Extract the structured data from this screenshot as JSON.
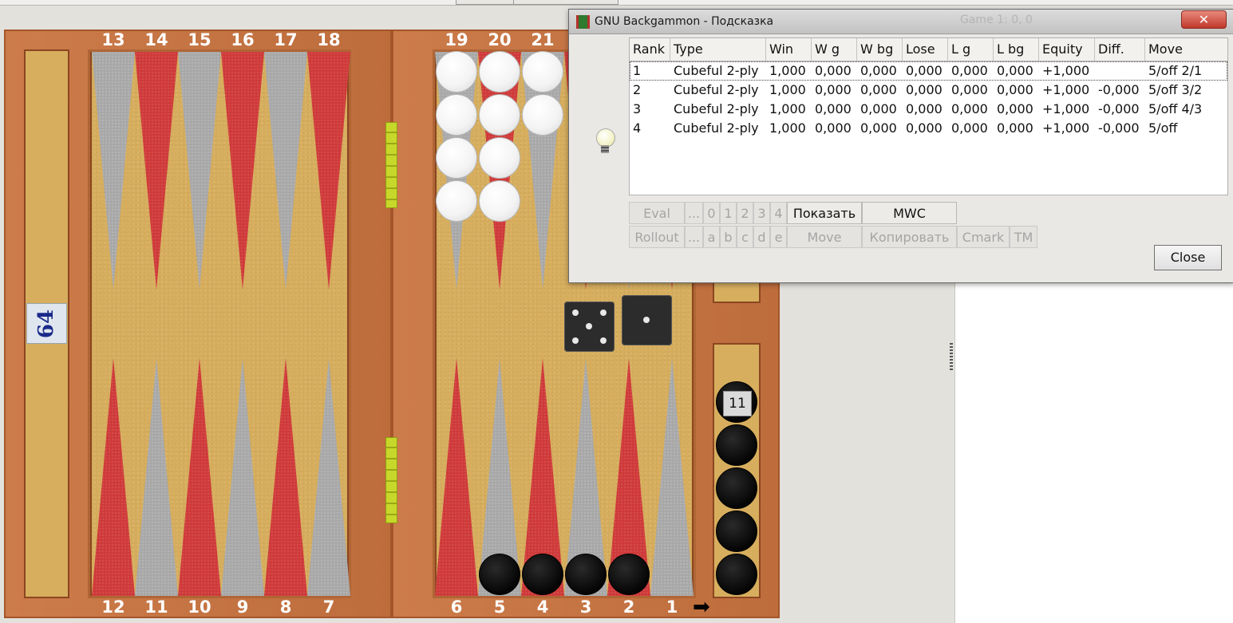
{
  "board": {
    "top_point_numbers": [
      "13",
      "14",
      "15",
      "16",
      "17",
      "18",
      "19",
      "20",
      "21"
    ],
    "bottom_point_numbers": [
      "12",
      "11",
      "10",
      "9",
      "8",
      "7",
      "6",
      "5",
      "4",
      "3",
      "2",
      "1"
    ],
    "cube_value": "64",
    "dice": [
      5,
      1
    ],
    "borne_off_black_count": "11",
    "triangle_colors": {
      "red": "#cf3a3a",
      "grey": "#a8a8a8"
    }
  },
  "dialog": {
    "title": "GNU Backgammon - Подсказка",
    "background_title": "Game 1: 0, 0",
    "close_x": "✕",
    "columns": [
      "Rank",
      "Type",
      "Win",
      "W g",
      "W bg",
      "Lose",
      "L g",
      "L bg",
      "Equity",
      "Diff.",
      "Move"
    ],
    "rows": [
      {
        "rank": "1",
        "type": "Cubeful 2-ply",
        "win": "1,000",
        "wg": "0,000",
        "wbg": "0,000",
        "lose": "0,000",
        "lg": "0,000",
        "lbg": "0,000",
        "equity": "+1,000",
        "diff": "",
        "move": "5/off 2/1"
      },
      {
        "rank": "2",
        "type": "Cubeful 2-ply",
        "win": "1,000",
        "wg": "0,000",
        "wbg": "0,000",
        "lose": "0,000",
        "lg": "0,000",
        "lbg": "0,000",
        "equity": "+1,000",
        "diff": "-0,000",
        "move": "5/off 3/2"
      },
      {
        "rank": "3",
        "type": "Cubeful 2-ply",
        "win": "1,000",
        "wg": "0,000",
        "wbg": "0,000",
        "lose": "0,000",
        "lg": "0,000",
        "lbg": "0,000",
        "equity": "+1,000",
        "diff": "-0,000",
        "move": "5/off 4/3"
      },
      {
        "rank": "4",
        "type": "Cubeful 2-ply",
        "win": "1,000",
        "wg": "0,000",
        "wbg": "0,000",
        "lose": "0,000",
        "lg": "0,000",
        "lbg": "0,000",
        "equity": "+1,000",
        "diff": "-0,000",
        "move": "5/off"
      }
    ],
    "buttons": {
      "eval": "Eval",
      "eval_more": "...",
      "ply0": "0",
      "ply1": "1",
      "ply2": "2",
      "ply3": "3",
      "ply4": "4",
      "show": "Показать",
      "mwc": "MWC",
      "rollout": "Rollout",
      "rollout_more": "...",
      "ra": "a",
      "rb": "b",
      "rc": "c",
      "rd": "d",
      "re": "e",
      "move": "Move",
      "copy": "Копировать",
      "cmark": "Cmark",
      "tm": "TM",
      "close": "Close"
    }
  }
}
